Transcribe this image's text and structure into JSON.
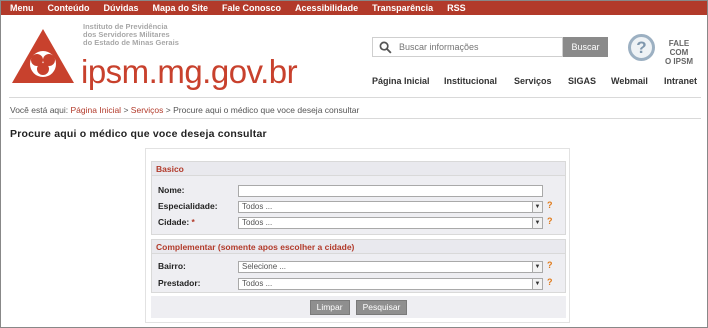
{
  "topnav": [
    "Menu",
    "Conteúdo",
    "Dúvidas",
    "Mapa do Site",
    "Fale Conosco",
    "Acessibilidade",
    "Transparência",
    "RSS"
  ],
  "brand": {
    "institute_lines": [
      "Instituto de Previdência",
      "dos Servidores Militares",
      "do Estado de Minas Gerais"
    ],
    "domain": "ipsm.mg.gov.br"
  },
  "search": {
    "placeholder": "Buscar informações",
    "button": "Buscar"
  },
  "fale": {
    "icon": "question-mark-icon",
    "line1": "FALE COM",
    "line2": "O IPSM"
  },
  "mainnav": [
    "Página Inicial",
    "Institucional",
    "Serviços",
    "SIGAS",
    "Webmail",
    "Intranet"
  ],
  "breadcrumb": {
    "prefix": "Você está aqui:",
    "home": "Página Inicial",
    "sep": ">",
    "services": "Serviços",
    "current": "Procure aqui o médico que voce deseja consultar"
  },
  "page_title": "Procure aqui o médico que voce deseja consultar",
  "form": {
    "basico": {
      "title": "Basico",
      "nome_label": "Nome:",
      "nome_value": "",
      "especialidade_label": "Especialidade:",
      "especialidade_value": "Todos ...",
      "cidade_label": "Cidade:",
      "cidade_required": "*",
      "cidade_value": "Todos ..."
    },
    "complementar": {
      "title": "Complementar (somente apos escolher a cidade)",
      "bairro_label": "Bairro:",
      "bairro_value": "Selecione ...",
      "prestador_label": "Prestador:",
      "prestador_value": "Todos ..."
    },
    "help_glyph": "?",
    "limpar": "Limpar",
    "pesquisar": "Pesquisar"
  },
  "colors": {
    "brand_red": "#b23a2a",
    "help_orange": "#e07a1a"
  }
}
